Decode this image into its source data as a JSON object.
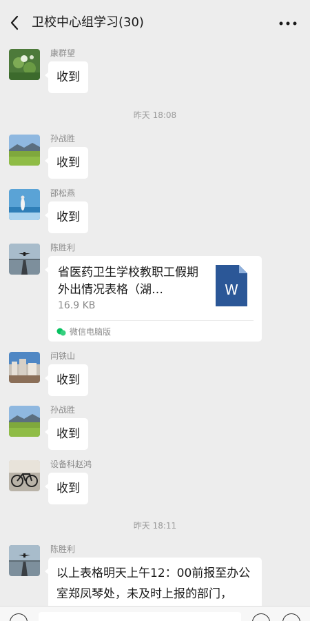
{
  "header": {
    "title": "卫校中心组学习(30)"
  },
  "messages": [
    {
      "sender": "康群望",
      "text": "收到"
    },
    {
      "sender": "孙战胜",
      "text": "收到"
    },
    {
      "sender": "邵松燕",
      "text": "收到"
    },
    {
      "sender": "陈胜利",
      "file": {
        "name": "省医药卫生学校教职工假期外出情况表格（湖…",
        "size": "16.9 KB",
        "source": "微信电脑版",
        "icon": "word-icon"
      }
    },
    {
      "sender": "闫铁山",
      "text": "收到"
    },
    {
      "sender": "孙战胜",
      "text": "收到"
    },
    {
      "sender": "设备科赵鸿",
      "text": "收到"
    },
    {
      "sender": "陈胜利",
      "text": "以上表格明天上午12：00前报至办公室郑凤琴处，未及时上报的部门，"
    }
  ],
  "timestamps": [
    "昨天 18:08",
    "昨天 18:11"
  ],
  "colors": {
    "background": "#ededed",
    "bubble": "#ffffff",
    "word_blue": "#2b5797",
    "wechat_green": "#07c160"
  }
}
